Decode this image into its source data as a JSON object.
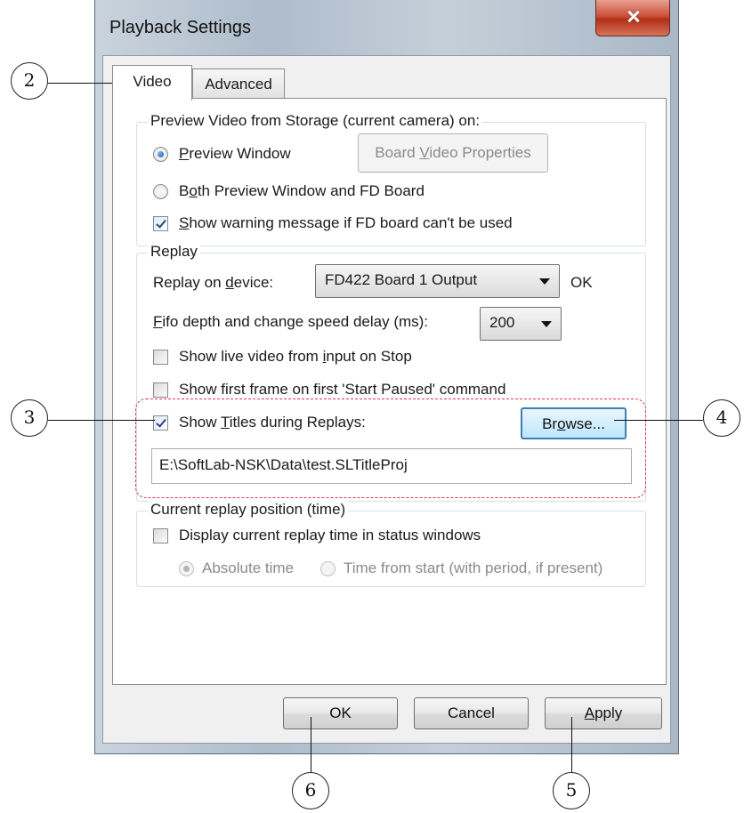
{
  "window": {
    "title": "Playback Settings"
  },
  "tabs": [
    {
      "label": "Video",
      "active": true
    },
    {
      "label": "Advanced",
      "active": false
    }
  ],
  "preview_group": {
    "title": "Preview Video from Storage (current camera) on:",
    "radio_preview_window": {
      "label_u": "P",
      "label_rest": "review Window",
      "checked": true
    },
    "board_video_properties": {
      "label_a": "Board ",
      "label_u": "V",
      "label_b": "ideo Properties",
      "enabled": false
    },
    "radio_both": {
      "label_a": "B",
      "label_u": "o",
      "label_b": "th Preview Window and FD Board",
      "checked": false
    },
    "show_warning": {
      "label_u": "S",
      "label_rest": "how warning message if FD board can't be used",
      "checked": true
    }
  },
  "replay_group": {
    "title": "Replay",
    "device_label_a": "Replay on ",
    "device_label_u": "d",
    "device_label_b": "evice:",
    "device_value": "FD422 Board 1 Output",
    "device_status": "OK",
    "fifo_label_u": "F",
    "fifo_label_rest": "ifo depth and change speed delay (ms):",
    "fifo_value": "200",
    "show_live": {
      "label_a": "Show live video from ",
      "label_u": "i",
      "label_b": "nput on Stop",
      "checked": false
    },
    "show_first_frame": {
      "label": "Show first frame on first 'Start Paused' command",
      "checked": false
    },
    "show_titles": {
      "label_a": "Show ",
      "label_u": "T",
      "label_b": "itles during Replays:",
      "checked": true
    },
    "browse_a": "Br",
    "browse_u": "o",
    "browse_b": "wse...",
    "title_project_path": "E:\\SoftLab-NSK\\Data\\test.SLTitleProj"
  },
  "position_group": {
    "title": "Current replay position (time)",
    "display_time": {
      "label": "Display current replay time in status windows",
      "checked": false
    },
    "radio_absolute": {
      "label": "Absolute time",
      "checked": true,
      "enabled": false
    },
    "radio_from_start": {
      "label": "Time from start (with period, if present)",
      "checked": false,
      "enabled": false
    }
  },
  "buttons": {
    "ok": "OK",
    "cancel": "Cancel",
    "apply_u": "A",
    "apply_rest": "pply"
  },
  "callouts": [
    "2",
    "3",
    "4",
    "5",
    "6"
  ]
}
